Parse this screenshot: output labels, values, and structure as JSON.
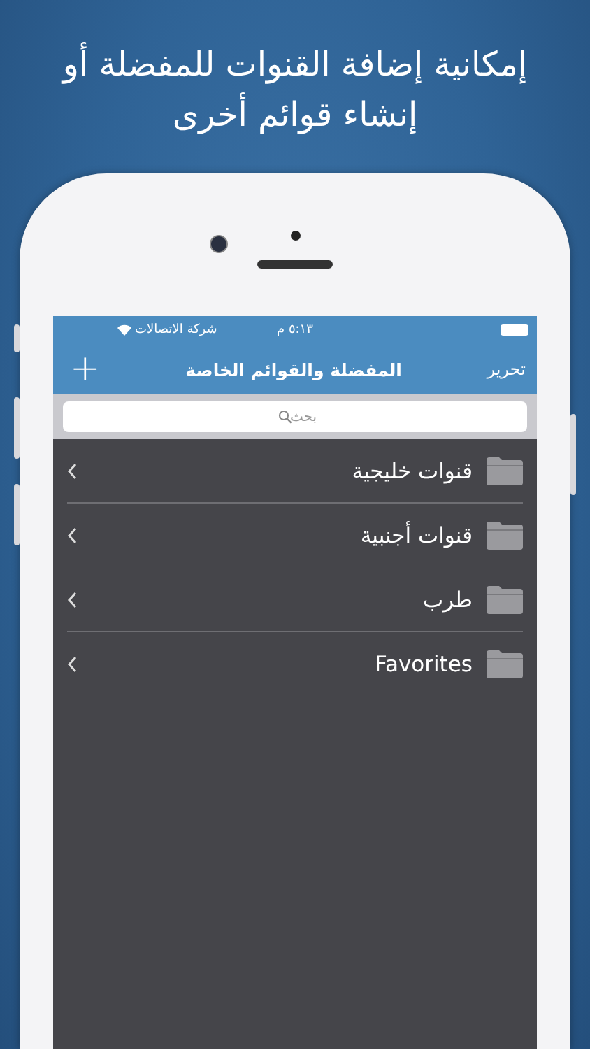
{
  "headline": "إمكانية إضافة القنوات للمفضلة أو إنشاء قوائم أخرى",
  "status_bar": {
    "carrier": "شركة الاتصالات",
    "time": "٥:١٣ م"
  },
  "nav_bar": {
    "add_button": "+",
    "title": "المفضلة والقوائم الخاصة",
    "edit_button": "تحرير"
  },
  "search": {
    "placeholder": "بحث"
  },
  "folders": [
    {
      "name": "قنوات خليجية",
      "divider_below": true
    },
    {
      "name": "قنوات أجنبية",
      "divider_below": false
    },
    {
      "name": "طرب",
      "divider_below": true
    },
    {
      "name": "Favorites",
      "divider_below": false
    }
  ]
}
